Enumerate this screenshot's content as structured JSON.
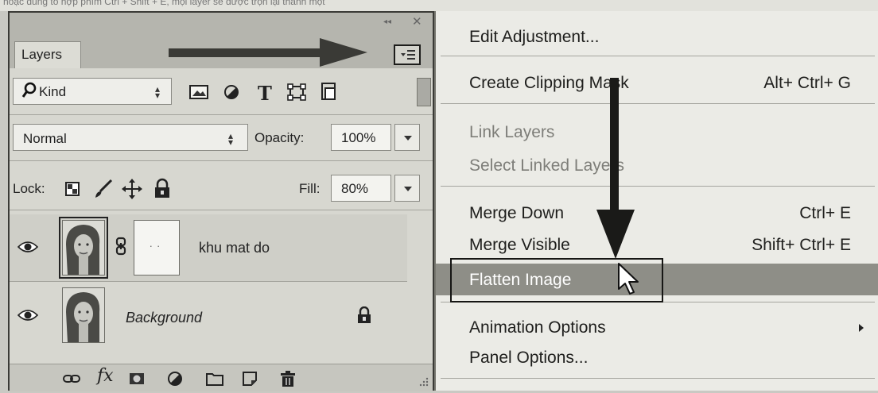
{
  "top_strip_text": "hoặc dùng tổ hợp phím Ctrl + Shift + E, mọi layer sẽ được trộn lại thành một",
  "layers_panel": {
    "tab_label": "Layers",
    "filter": {
      "kind_label": "Kind",
      "icons": [
        "image-filter-icon",
        "adjustment-filter-icon",
        "type-filter-icon",
        "shape-filter-icon",
        "smart-object-filter-icon"
      ]
    },
    "blend_mode": "Normal",
    "opacity_label": "Opacity:",
    "opacity_value": "100%",
    "lock_label": "Lock:",
    "fill_label": "Fill:",
    "fill_value": "80%",
    "layers": [
      {
        "name": "khu mat do",
        "visible": true,
        "has_mask": true,
        "selected": true
      },
      {
        "name": "Background",
        "visible": true,
        "locked": true,
        "selected": false
      }
    ],
    "footer_icons": [
      "link-layers-icon",
      "fx-icon",
      "add-mask-icon",
      "adjustment-layer-icon",
      "new-group-icon",
      "new-layer-icon",
      "delete-icon"
    ],
    "fx_label": "fx"
  },
  "context_menu": {
    "items": [
      {
        "label": "Edit Adjustment...",
        "shortcut": "",
        "disabled": false
      },
      {
        "label": "Create Clipping Mask",
        "shortcut": "Alt+ Ctrl+ G",
        "disabled": false
      },
      {
        "label": "Link Layers",
        "shortcut": "",
        "disabled": true
      },
      {
        "label": "Select Linked Layers",
        "shortcut": "",
        "disabled": true
      },
      {
        "label": "Merge Down",
        "shortcut": "Ctrl+ E",
        "disabled": false
      },
      {
        "label": "Merge Visible",
        "shortcut": "Shift+ Ctrl+ E",
        "disabled": false
      },
      {
        "label": "Flatten Image",
        "shortcut": "",
        "disabled": false,
        "highlighted": true
      },
      {
        "label": "Animation Options",
        "shortcut": "",
        "disabled": false,
        "has_submenu": true
      },
      {
        "label": "Panel Options...",
        "shortcut": "",
        "disabled": false
      }
    ]
  },
  "colors": {
    "menu_highlight": "#8e8e87",
    "panel_bg": "#d7d7d0",
    "annotation": "#161614"
  }
}
